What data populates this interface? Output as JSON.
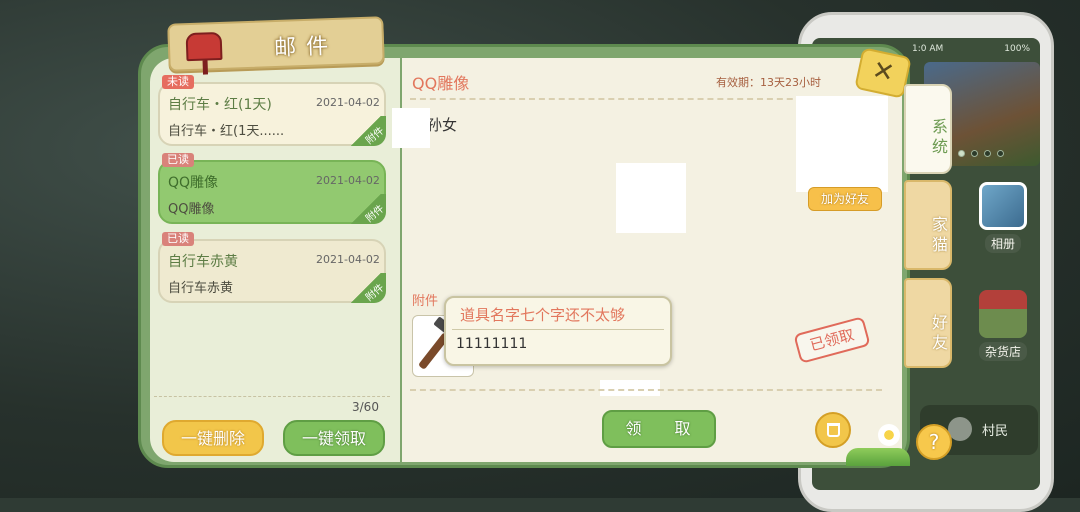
{
  "window": {
    "title": "邮件"
  },
  "mail_list": {
    "items": [
      {
        "tag": "未读",
        "subject": "自行车・红(1天)",
        "date": "2021-04-02",
        "preview": "自行车・红(1天......",
        "attachment_label": "附件",
        "state": "unread"
      },
      {
        "tag": "已读",
        "subject": "QQ雕像",
        "date": "2021-04-02",
        "preview": "QQ雕像",
        "attachment_label": "附件",
        "state": "selected"
      },
      {
        "tag": "已读",
        "subject": "自行车赤黄",
        "date": "2021-04-02",
        "preview": "自行车赤黄",
        "attachment_label": "附件",
        "state": "read"
      }
    ],
    "count": "3/60",
    "delete_all_label": "一键删除",
    "claim_all_label": "一键领取"
  },
  "detail": {
    "title": "QQ雕像",
    "validity": "有效期：13天23小时",
    "sender": "小孙女",
    "add_friend_label": "加为好友",
    "attachment_header": "附件",
    "claimed_stamp": "已领取",
    "claim_label": "领 取"
  },
  "tooltip": {
    "item_name": "道具名字七个字还不太够",
    "item_desc": "11111111"
  },
  "side_tabs": [
    {
      "label": "系统",
      "active": true
    },
    {
      "label": "家猫",
      "active": false
    },
    {
      "label": "好友",
      "active": false
    }
  ],
  "phone": {
    "time": "1:0 AM",
    "battery": "100%",
    "apps": [
      {
        "label": "相册"
      },
      {
        "label": "杂货店"
      }
    ],
    "villager_label": "村民"
  },
  "colors": {
    "frame_green": "#7fa66e",
    "accent_orange": "#e2775d",
    "button_yellow": "#f2c64a",
    "button_green": "#7fbf5c"
  },
  "icons": [
    "mailbox-icon",
    "close-icon",
    "trash-icon",
    "help-icon",
    "hammer-icon"
  ]
}
